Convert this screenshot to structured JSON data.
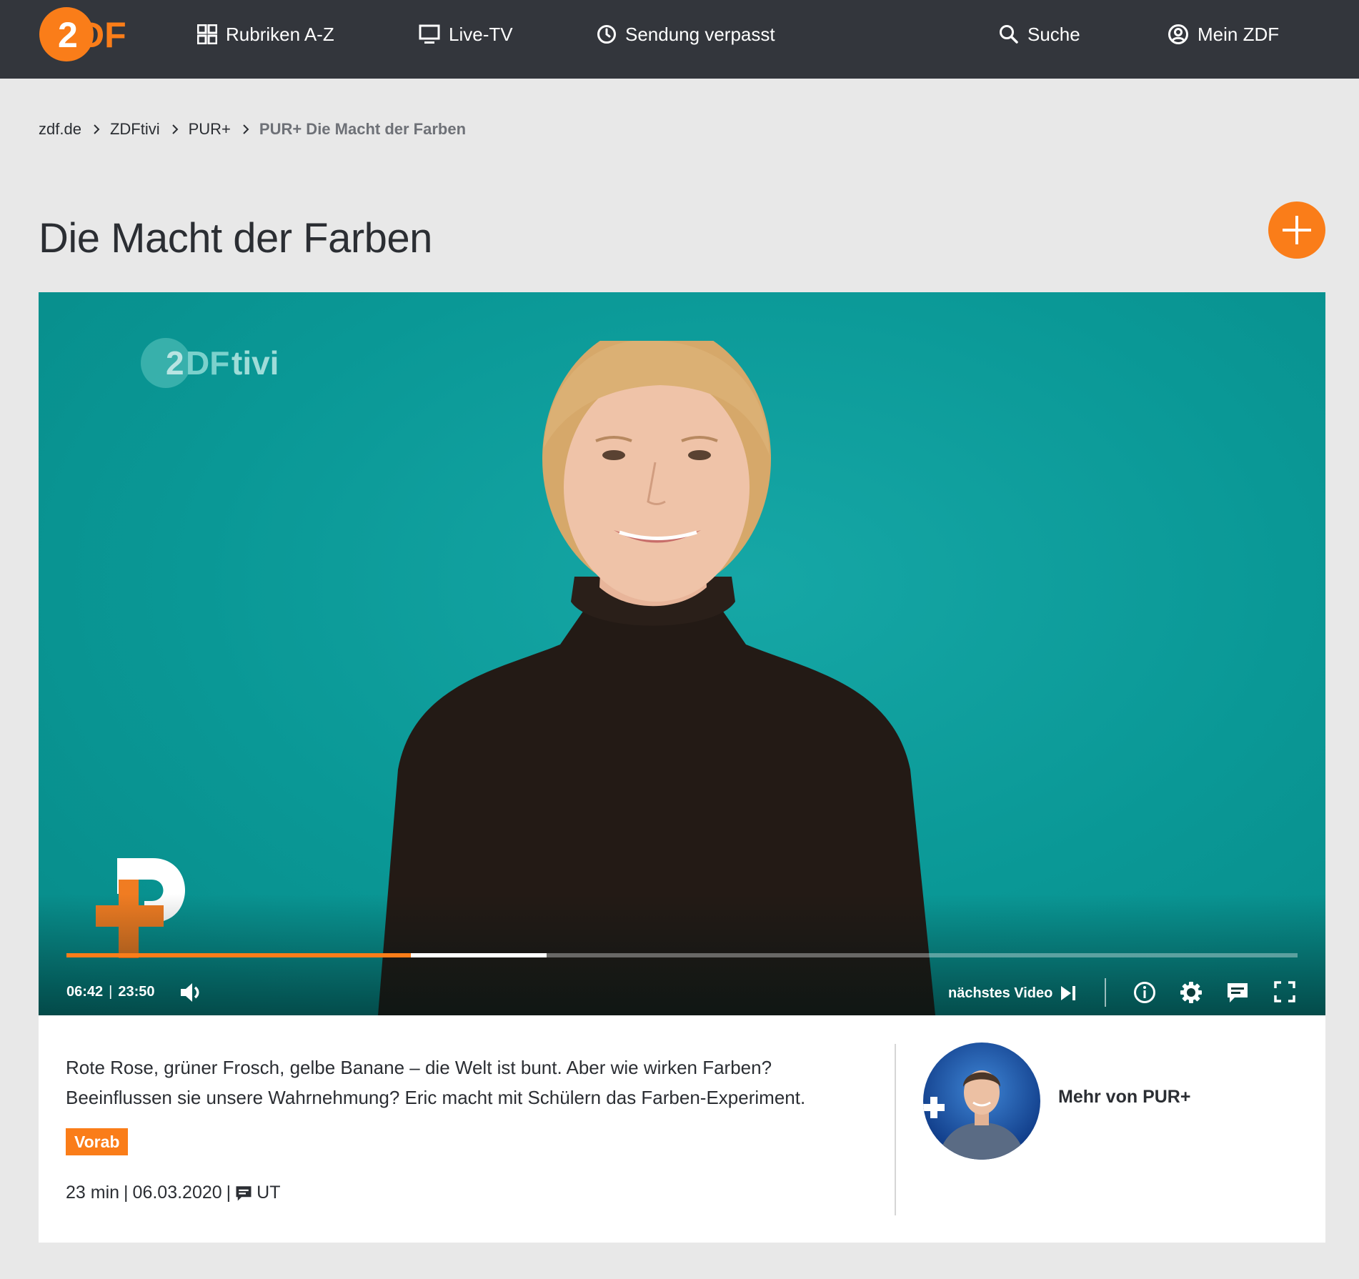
{
  "brand": {
    "accent": "#fa7d19",
    "nav_bg": "#33363c"
  },
  "nav": {
    "logo_text": "ZDF",
    "items": [
      {
        "label": "Rubriken A-Z",
        "icon": "grid-icon"
      },
      {
        "label": "Live-TV",
        "icon": "tv-icon"
      },
      {
        "label": "Sendung verpasst",
        "icon": "clock-icon"
      },
      {
        "label": "Suche",
        "icon": "search-icon"
      },
      {
        "label": "Mein ZDF",
        "icon": "user-icon"
      }
    ]
  },
  "breadcrumb": [
    "zdf.de",
    "ZDFtivi",
    "PUR+",
    "PUR+ Die Macht der Farben"
  ],
  "title": "Die Macht der Farben",
  "player": {
    "current_time": "06:42",
    "duration": "23:50",
    "played_fraction": 0.28,
    "buffered_fraction": 0.39,
    "next_label": "nächstes Video"
  },
  "info": {
    "description": "Rote Rose, grüner Frosch, gelbe Banane – die Welt ist bunt. Aber wie wirken Farben? Beeinflussen sie unsere Wahrnehmung? Eric macht mit Schülern das Farben-Experiment.",
    "badge": "Vorab",
    "duration": "23 min",
    "date": "06.03.2020",
    "subtitles": "UT",
    "more_label": "Mehr von PUR+"
  }
}
